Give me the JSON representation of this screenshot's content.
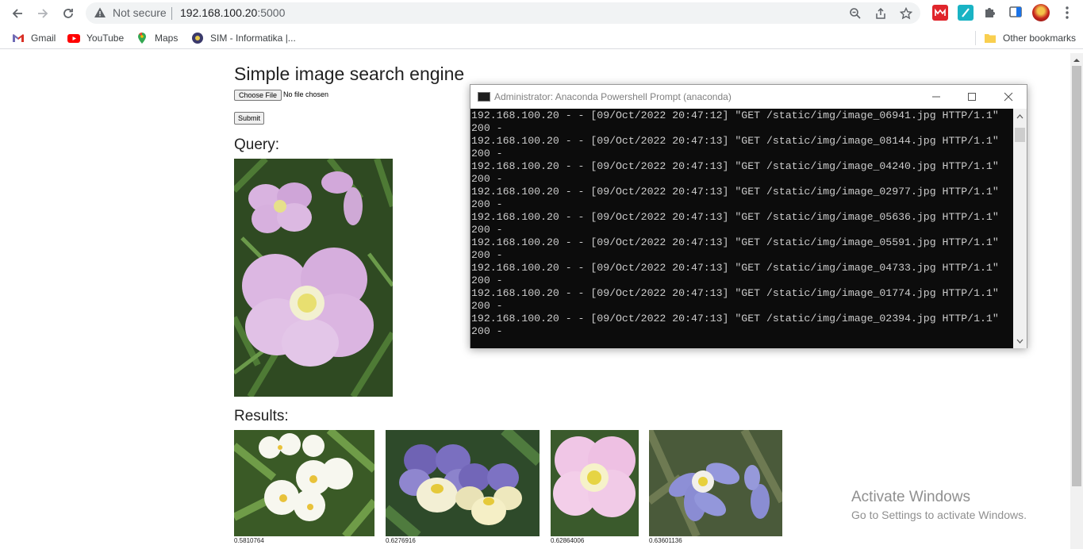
{
  "browser": {
    "not_secure": "Not secure",
    "url_host": "192.168.100.20",
    "url_port": ":5000",
    "bookmarks": [
      {
        "label": "Gmail"
      },
      {
        "label": "YouTube"
      },
      {
        "label": "Maps"
      },
      {
        "label": "SIM - Informatika |..."
      }
    ],
    "other_bookmarks": "Other bookmarks"
  },
  "page": {
    "title": "Simple image search engine",
    "choose_file": "Choose File",
    "no_file": "No file chosen",
    "submit": "Submit",
    "query_heading": "Query:",
    "results_heading": "Results:",
    "results": [
      {
        "score": "0.5810764"
      },
      {
        "score": "0.6276916"
      },
      {
        "score": "0.62864006"
      },
      {
        "score": "0.63601136"
      }
    ]
  },
  "terminal": {
    "title": "Administrator: Anaconda Powershell Prompt (anaconda)",
    "lines": [
      "192.168.100.20 - - [09/Oct/2022 20:47:12] \"GET /static/img/image_06941.jpg HTTP/1.1\"",
      "200 -",
      "192.168.100.20 - - [09/Oct/2022 20:47:13] \"GET /static/img/image_08144.jpg HTTP/1.1\"",
      "200 -",
      "192.168.100.20 - - [09/Oct/2022 20:47:13] \"GET /static/img/image_04240.jpg HTTP/1.1\"",
      "200 -",
      "192.168.100.20 - - [09/Oct/2022 20:47:13] \"GET /static/img/image_02977.jpg HTTP/1.1\"",
      "200 -",
      "192.168.100.20 - - [09/Oct/2022 20:47:13] \"GET /static/img/image_05636.jpg HTTP/1.1\"",
      "200 -",
      "192.168.100.20 - - [09/Oct/2022 20:47:13] \"GET /static/img/image_05591.jpg HTTP/1.1\"",
      "200 -",
      "192.168.100.20 - - [09/Oct/2022 20:47:13] \"GET /static/img/image_04733.jpg HTTP/1.1\"",
      "200 -",
      "192.168.100.20 - - [09/Oct/2022 20:47:13] \"GET /static/img/image_01774.jpg HTTP/1.1\"",
      "200 -",
      "192.168.100.20 - - [09/Oct/2022 20:47:13] \"GET /static/img/image_02394.jpg HTTP/1.1\"",
      "200 -"
    ]
  },
  "watermark": {
    "line1": "Activate Windows",
    "line2": "Go to Settings to activate Windows."
  }
}
